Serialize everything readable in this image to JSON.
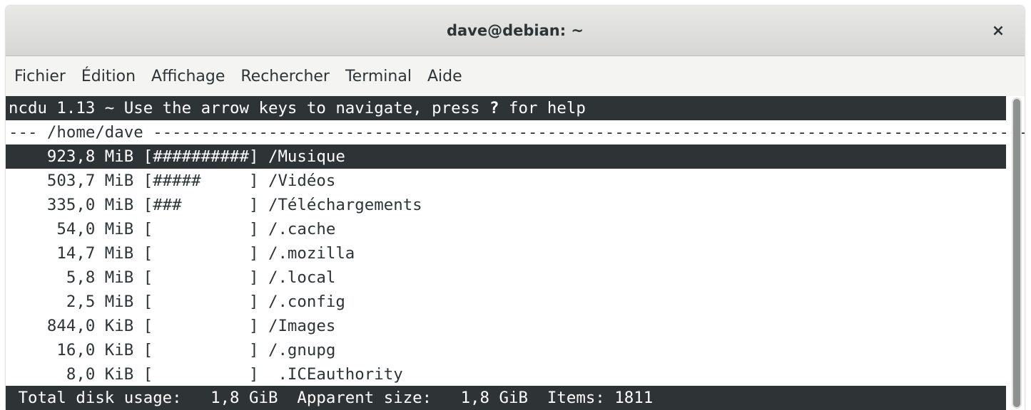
{
  "window": {
    "title": "dave@debian: ~",
    "close_glyph": "×"
  },
  "menubar": {
    "items": [
      "Fichier",
      "Édition",
      "Affichage",
      "Rechercher",
      "Terminal",
      "Aide"
    ]
  },
  "ncdu": {
    "top_prefix": "ncdu 1.13 ~ Use the arrow keys to navigate, press ",
    "top_key": "?",
    "top_suffix": " for help",
    "path_line": "--- /home/dave ---------------------------------------------------------------------------------------------",
    "rows": [
      {
        "size": "923,8 MiB",
        "bar": "##########",
        "name": "/Musique",
        "selected": true
      },
      {
        "size": "503,7 MiB",
        "bar": "#####     ",
        "name": "/Vidéos",
        "selected": false
      },
      {
        "size": "335,0 MiB",
        "bar": "###       ",
        "name": "/Téléchargements",
        "selected": false
      },
      {
        "size": "54,0 MiB",
        "bar": "          ",
        "name": "/.cache",
        "selected": false
      },
      {
        "size": "14,7 MiB",
        "bar": "          ",
        "name": "/.mozilla",
        "selected": false
      },
      {
        "size": "5,8 MiB",
        "bar": "          ",
        "name": "/.local",
        "selected": false
      },
      {
        "size": "2,5 MiB",
        "bar": "          ",
        "name": "/.config",
        "selected": false
      },
      {
        "size": "844,0 KiB",
        "bar": "          ",
        "name": "/Images",
        "selected": false
      },
      {
        "size": "16,0 KiB",
        "bar": "          ",
        "name": "/.gnupg",
        "selected": false
      },
      {
        "size": "8,0 KiB",
        "bar": "          ",
        "name": " .ICEauthority",
        "selected": false
      }
    ],
    "footer": " Total disk usage:   1,8 GiB  Apparent size:   1,8 GiB  Items: 1811"
  },
  "colors": {
    "terminal_fg": "#2e3436",
    "terminal_bg": "#ffffff",
    "inverse_bg": "#2e3436",
    "inverse_fg": "#ffffff",
    "titlebar_bg": "#dcdcda",
    "menubar_bg": "#f4f4f3"
  }
}
